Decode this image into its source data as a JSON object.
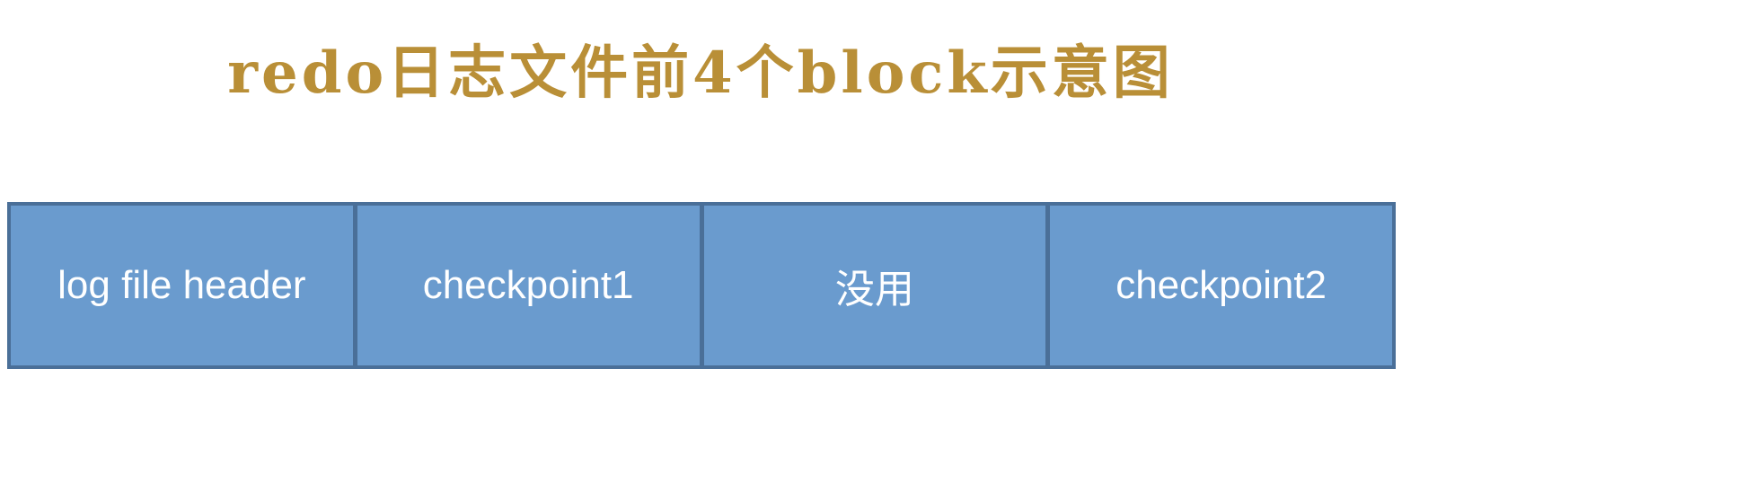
{
  "title": "redo日志文件前4个block示意图",
  "blocks": [
    {
      "label": "log file header"
    },
    {
      "label": "checkpoint1"
    },
    {
      "label": "没用"
    },
    {
      "label": "checkpoint2"
    }
  ],
  "colors": {
    "title": "#b98f37",
    "block_fill": "#6a9bce",
    "block_border": "#4a6f98",
    "block_text": "#ffffff"
  }
}
